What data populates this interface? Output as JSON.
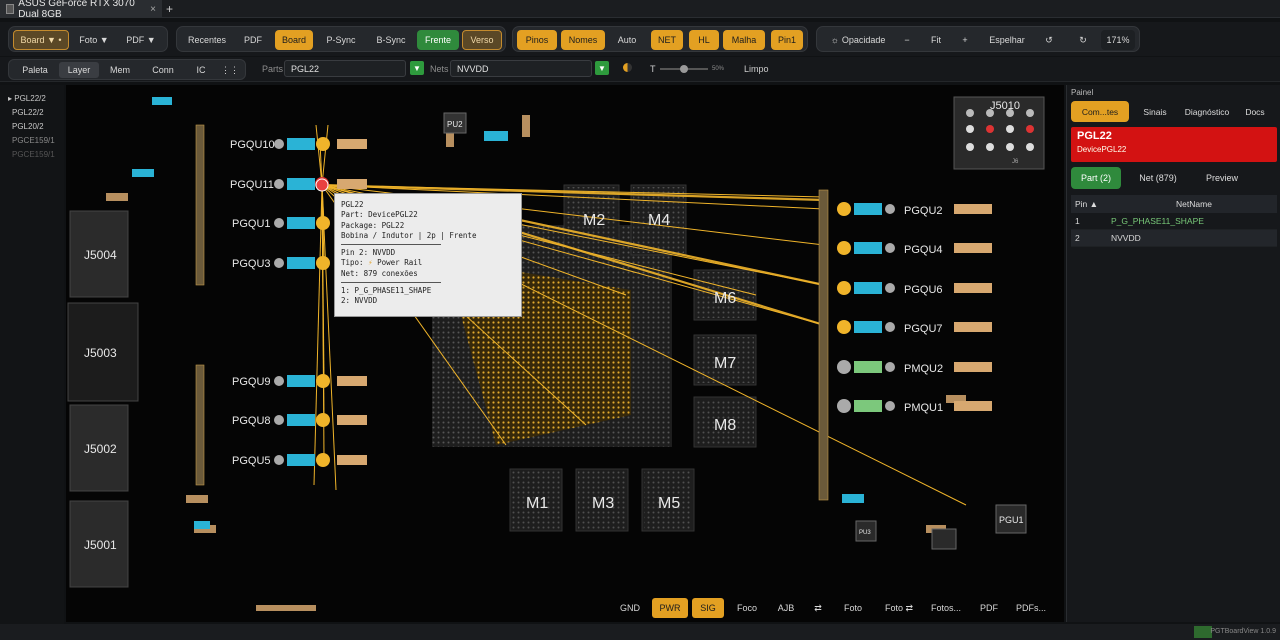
{
  "window": {
    "tab_title": "ASUS GeForce RTX 3070 Dual 8GB",
    "close_glyph": "×",
    "new_tab_glyph": "+"
  },
  "toolbar1": {
    "board": "Board ▼ •",
    "foto": "Foto ▼",
    "pdf": "PDF ▼",
    "recentes": "Recentes",
    "pdf2": "PDF",
    "board2": "Board",
    "psync": "P-Sync",
    "bsync": "B-Sync",
    "frente": "Frente",
    "verso": "Verso",
    "pinos": "Pinos",
    "nomes": "Nomes",
    "auto": "Auto",
    "net": "NET",
    "hl": "HL",
    "malha": "Malha",
    "pin1": "Pin1",
    "opacidade": "Opacidade",
    "minus": "−",
    "fit": "Fit",
    "plus": "+",
    "espelhar": "Espelhar",
    "rotl": "↺",
    "rotr": "↻",
    "zoom": "171%"
  },
  "toolbar2": {
    "paleta": "Paleta",
    "layer": "Layer",
    "mem": "Mem",
    "conn": "Conn",
    "ic": "IC",
    "grid_glyph": "⋮⋮",
    "parts_label": "Parts",
    "parts_value": "PGL22",
    "nets_label": "Nets",
    "nets_value": "NVVDD",
    "t_label": "T",
    "slider_pct": "50%",
    "limpo": "Limpo",
    "dropdown_glyph": "▼"
  },
  "left_list": [
    "PGL22/2",
    "PGL22/2",
    "PGL20/2",
    "PGCE159/1",
    "PGCE159/1"
  ],
  "board": {
    "connectors": [
      "J5004",
      "J5003",
      "J5002",
      "J5001",
      "J5010"
    ],
    "memory": [
      "M2",
      "M4",
      "M6",
      "M7",
      "M8",
      "M1",
      "M3",
      "M5"
    ],
    "left_phases": [
      "PGQU10",
      "PGQU11",
      "PGQU1",
      "PGQU3",
      "PGQU9",
      "PGQU8",
      "PGQU5"
    ],
    "right_phases": [
      "PGQU2",
      "PGQU4",
      "PGQU6",
      "PGQU7",
      "PMQU2",
      "PMQU1"
    ],
    "pu_labels": [
      "PU2",
      "PGU1",
      "PU3"
    ],
    "small_label": "J6"
  },
  "tooltip": {
    "l1": "PGL22",
    "l2": "Part: DevicePGL22",
    "l3": "Package: PGL22",
    "l4": "Bobina / Indutor  |  2p  |  Frente",
    "l5": "Pin 2: NVVDD",
    "l6_label": "Tipo:",
    "l6_icon": "⚡",
    "l6_value": "Power Rail",
    "l7": "Net: 879 conexões",
    "l8": "1: P_G_PHASE11_SHAPE",
    "l9": "2: NVVDD"
  },
  "bottom_bar": [
    "GND",
    "PWR",
    "SIG",
    "Foco",
    "AJB",
    "⇄",
    "Foto",
    "Foto ⇄",
    "Fotos...",
    "PDF",
    "PDFs..."
  ],
  "right_panel": {
    "title": "Painel",
    "tabs": [
      "Com...tes",
      "Sinais",
      "Diagnóstico",
      "Docs"
    ],
    "part_name": "PGL22",
    "part_device": "DevicePGL22",
    "subtabs": [
      "Part (2)",
      "Net (879)",
      "Preview"
    ],
    "table": {
      "headers": [
        "Pin ▲",
        "NetName"
      ],
      "rows": [
        {
          "pin": "1",
          "net": "P_G_PHASE11_SHAPE"
        },
        {
          "pin": "2",
          "net": "NVVDD"
        }
      ]
    }
  },
  "status": {
    "app": "PGTBoardView 1.0.9"
  },
  "colors": {
    "accent_orange": "#e3a022",
    "green": "#2f8a3c",
    "red_card": "#d31212",
    "net_yellow": "#f0b42a",
    "pad_cyan": "#2ab3d6"
  }
}
